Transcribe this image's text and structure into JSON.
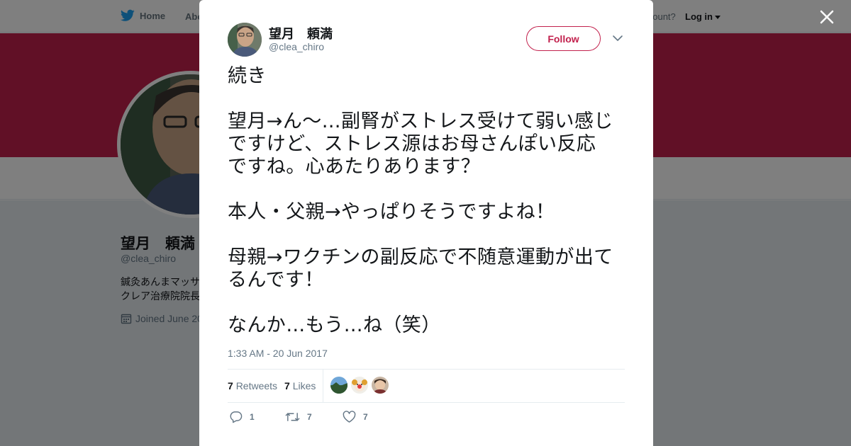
{
  "nav": {
    "home_label": "Home",
    "about_label": "Abo",
    "account_prompt": "account?",
    "login_label": "Log in"
  },
  "profile": {
    "name": "望月　頼満",
    "handle": "@clea_chiro",
    "bio_lines": [
      "鍼灸あんまマッサ",
      "クレア治療院院長"
    ],
    "joined": "Joined June 20",
    "banner_color": "#c2214d"
  },
  "tweet": {
    "author_name": "望月　頼満",
    "author_handle": "@clea_chiro",
    "follow_label": "Follow",
    "paragraphs": [
      "続き",
      "望月→ん〜…副腎がストレス受けて弱い感じ\nですけど、ストレス源はお母さんぽい反応\nですね。心あたりあります？",
      "本人・父親→やっぱりそうですよね！",
      "母親→ワクチンの副反応で不随意運動が出て\nるんです！",
      "なんか…もう…ね（笑）"
    ],
    "timestamp": "1:33 AM - 20 Jun 2017",
    "retweets_count": "7",
    "retweets_label": "Retweets",
    "likes_count": "7",
    "likes_label": "Likes",
    "actions": {
      "reply_count": "1",
      "retweet_count": "7",
      "like_count": "7"
    }
  },
  "colors": {
    "accent": "#c2214d",
    "twitter_blue": "#1da1f2",
    "muted_text": "#657786"
  },
  "icons": [
    "twitter-bird-icon",
    "calendar-icon",
    "close-icon",
    "chevron-down-icon",
    "reply-icon",
    "retweet-icon",
    "heart-icon"
  ]
}
